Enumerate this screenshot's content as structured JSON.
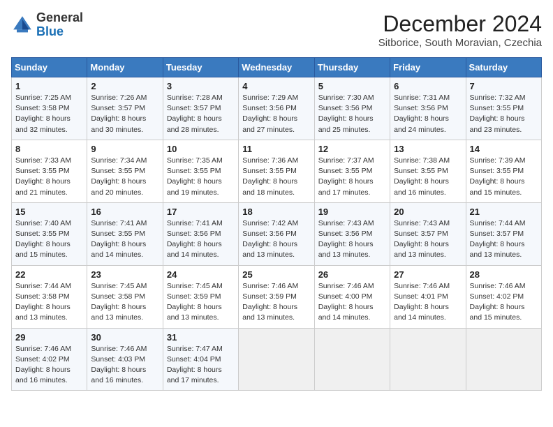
{
  "logo": {
    "general": "General",
    "blue": "Blue"
  },
  "header": {
    "month": "December 2024",
    "location": "Sitborice, South Moravian, Czechia"
  },
  "weekdays": [
    "Sunday",
    "Monday",
    "Tuesday",
    "Wednesday",
    "Thursday",
    "Friday",
    "Saturday"
  ],
  "weeks": [
    [
      {
        "day": 1,
        "sunrise": "7:25 AM",
        "sunset": "3:58 PM",
        "daylight": "8 hours and 32 minutes."
      },
      {
        "day": 2,
        "sunrise": "7:26 AM",
        "sunset": "3:57 PM",
        "daylight": "8 hours and 30 minutes."
      },
      {
        "day": 3,
        "sunrise": "7:28 AM",
        "sunset": "3:57 PM",
        "daylight": "8 hours and 28 minutes."
      },
      {
        "day": 4,
        "sunrise": "7:29 AM",
        "sunset": "3:56 PM",
        "daylight": "8 hours and 27 minutes."
      },
      {
        "day": 5,
        "sunrise": "7:30 AM",
        "sunset": "3:56 PM",
        "daylight": "8 hours and 25 minutes."
      },
      {
        "day": 6,
        "sunrise": "7:31 AM",
        "sunset": "3:56 PM",
        "daylight": "8 hours and 24 minutes."
      },
      {
        "day": 7,
        "sunrise": "7:32 AM",
        "sunset": "3:55 PM",
        "daylight": "8 hours and 23 minutes."
      }
    ],
    [
      {
        "day": 8,
        "sunrise": "7:33 AM",
        "sunset": "3:55 PM",
        "daylight": "8 hours and 21 minutes."
      },
      {
        "day": 9,
        "sunrise": "7:34 AM",
        "sunset": "3:55 PM",
        "daylight": "8 hours and 20 minutes."
      },
      {
        "day": 10,
        "sunrise": "7:35 AM",
        "sunset": "3:55 PM",
        "daylight": "8 hours and 19 minutes."
      },
      {
        "day": 11,
        "sunrise": "7:36 AM",
        "sunset": "3:55 PM",
        "daylight": "8 hours and 18 minutes."
      },
      {
        "day": 12,
        "sunrise": "7:37 AM",
        "sunset": "3:55 PM",
        "daylight": "8 hours and 17 minutes."
      },
      {
        "day": 13,
        "sunrise": "7:38 AM",
        "sunset": "3:55 PM",
        "daylight": "8 hours and 16 minutes."
      },
      {
        "day": 14,
        "sunrise": "7:39 AM",
        "sunset": "3:55 PM",
        "daylight": "8 hours and 15 minutes."
      }
    ],
    [
      {
        "day": 15,
        "sunrise": "7:40 AM",
        "sunset": "3:55 PM",
        "daylight": "8 hours and 15 minutes."
      },
      {
        "day": 16,
        "sunrise": "7:41 AM",
        "sunset": "3:55 PM",
        "daylight": "8 hours and 14 minutes."
      },
      {
        "day": 17,
        "sunrise": "7:41 AM",
        "sunset": "3:56 PM",
        "daylight": "8 hours and 14 minutes."
      },
      {
        "day": 18,
        "sunrise": "7:42 AM",
        "sunset": "3:56 PM",
        "daylight": "8 hours and 13 minutes."
      },
      {
        "day": 19,
        "sunrise": "7:43 AM",
        "sunset": "3:56 PM",
        "daylight": "8 hours and 13 minutes."
      },
      {
        "day": 20,
        "sunrise": "7:43 AM",
        "sunset": "3:57 PM",
        "daylight": "8 hours and 13 minutes."
      },
      {
        "day": 21,
        "sunrise": "7:44 AM",
        "sunset": "3:57 PM",
        "daylight": "8 hours and 13 minutes."
      }
    ],
    [
      {
        "day": 22,
        "sunrise": "7:44 AM",
        "sunset": "3:58 PM",
        "daylight": "8 hours and 13 minutes."
      },
      {
        "day": 23,
        "sunrise": "7:45 AM",
        "sunset": "3:58 PM",
        "daylight": "8 hours and 13 minutes."
      },
      {
        "day": 24,
        "sunrise": "7:45 AM",
        "sunset": "3:59 PM",
        "daylight": "8 hours and 13 minutes."
      },
      {
        "day": 25,
        "sunrise": "7:46 AM",
        "sunset": "3:59 PM",
        "daylight": "8 hours and 13 minutes."
      },
      {
        "day": 26,
        "sunrise": "7:46 AM",
        "sunset": "4:00 PM",
        "daylight": "8 hours and 14 minutes."
      },
      {
        "day": 27,
        "sunrise": "7:46 AM",
        "sunset": "4:01 PM",
        "daylight": "8 hours and 14 minutes."
      },
      {
        "day": 28,
        "sunrise": "7:46 AM",
        "sunset": "4:02 PM",
        "daylight": "8 hours and 15 minutes."
      }
    ],
    [
      {
        "day": 29,
        "sunrise": "7:46 AM",
        "sunset": "4:02 PM",
        "daylight": "8 hours and 16 minutes."
      },
      {
        "day": 30,
        "sunrise": "7:46 AM",
        "sunset": "4:03 PM",
        "daylight": "8 hours and 16 minutes."
      },
      {
        "day": 31,
        "sunrise": "7:47 AM",
        "sunset": "4:04 PM",
        "daylight": "8 hours and 17 minutes."
      },
      null,
      null,
      null,
      null
    ]
  ]
}
